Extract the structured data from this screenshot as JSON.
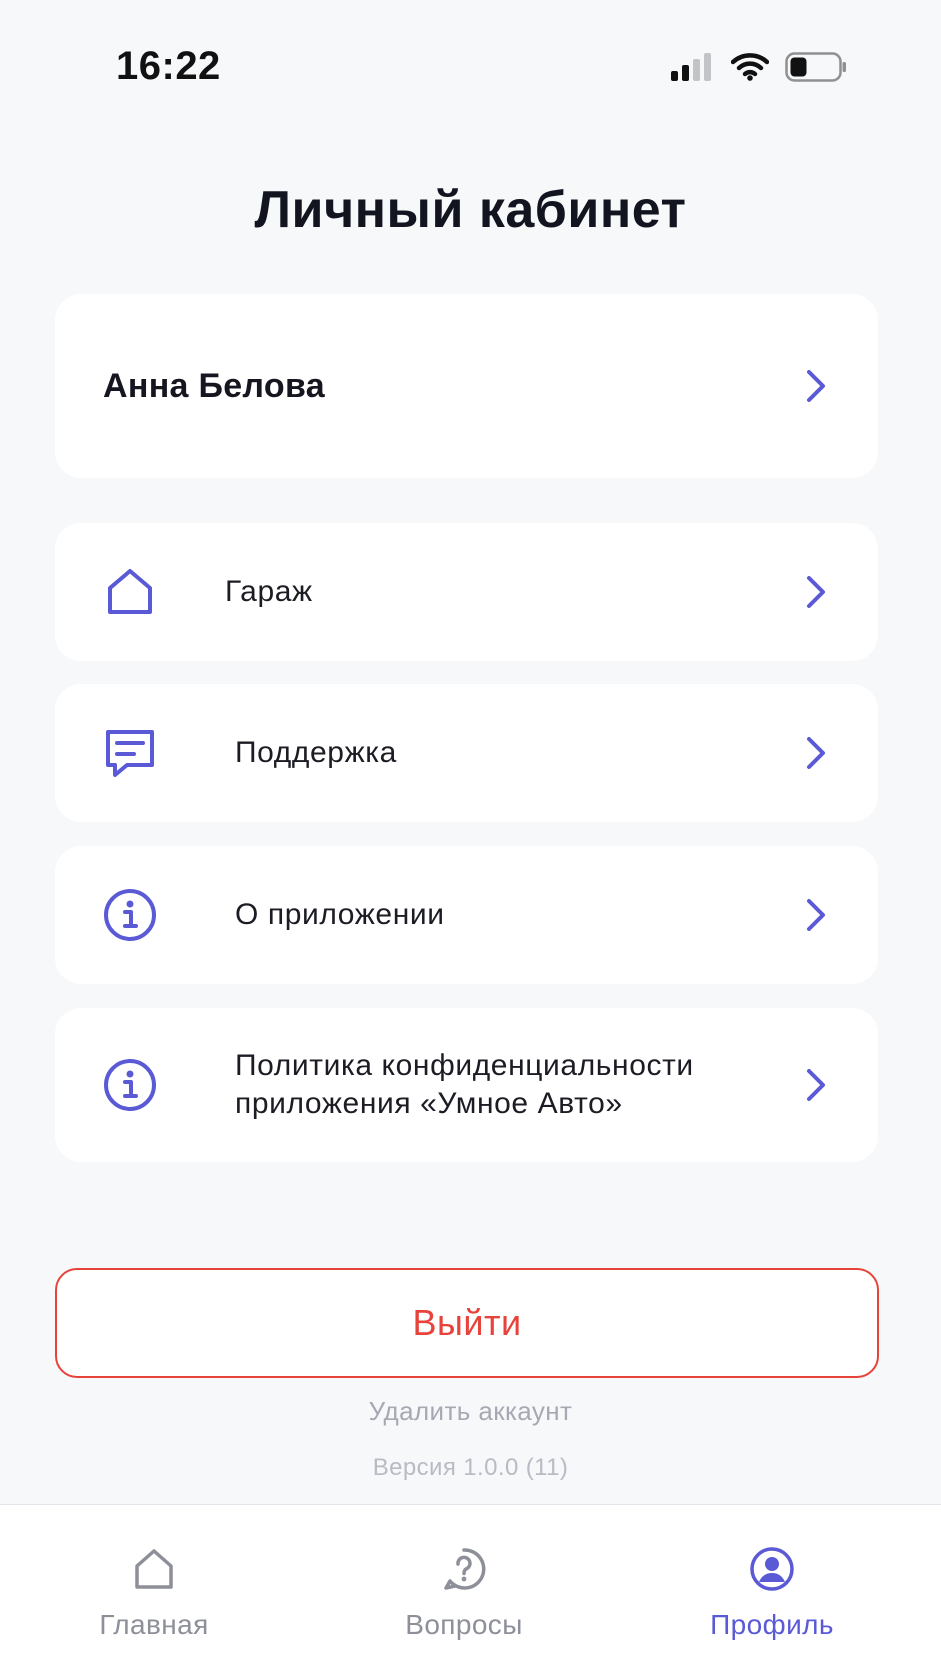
{
  "status_bar": {
    "time": "16:22",
    "icons": [
      "cellular-signal-icon",
      "wifi-icon",
      "battery-icon"
    ]
  },
  "header": {
    "title": "Личный кабинет"
  },
  "profile": {
    "name": "Анна Белова"
  },
  "menu": {
    "items": [
      {
        "label": "Гараж",
        "icon": "home-icon"
      },
      {
        "label": "Поддержка",
        "icon": "chat-icon"
      },
      {
        "label": "О приложении",
        "icon": "info-icon"
      },
      {
        "label_line1": "Политика конфиденциальности",
        "label_line2": "приложения «Умное Авто»",
        "icon": "info-icon"
      }
    ]
  },
  "actions": {
    "logout_label": "Выйти",
    "delete_account_label": "Удалить аккаунт",
    "version_text": "Версия 1.0.0 (11)"
  },
  "tab_bar": {
    "tabs": [
      {
        "label": "Главная",
        "icon": "home-icon",
        "active": false
      },
      {
        "label": "Вопросы",
        "icon": "question-icon",
        "active": false
      },
      {
        "label": "Профиль",
        "icon": "user-icon",
        "active": true
      }
    ]
  },
  "colors": {
    "accent": "#5b5ad6",
    "danger": "#e8433a",
    "background": "#f7f8fa",
    "inactive_tab": "#8d8f99"
  }
}
